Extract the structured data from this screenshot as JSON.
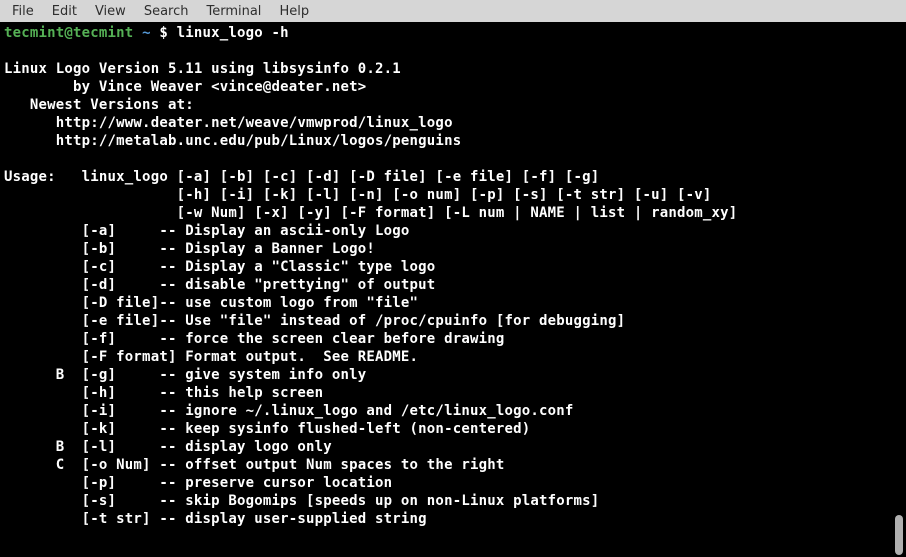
{
  "menubar": {
    "items": [
      "File",
      "Edit",
      "View",
      "Search",
      "Terminal",
      "Help"
    ]
  },
  "prompt": {
    "user": "tecmint@tecmint",
    "path": "~",
    "symbol": "$",
    "command": "linux_logo -h"
  },
  "output": {
    "lines": [
      "",
      "Linux Logo Version 5.11 using libsysinfo 0.2.1",
      "        by Vince Weaver <vince@deater.net>",
      "   Newest Versions at:",
      "      http://www.deater.net/weave/vmwprod/linux_logo",
      "      http://metalab.unc.edu/pub/Linux/logos/penguins",
      "",
      "Usage:   linux_logo [-a] [-b] [-c] [-d] [-D file] [-e file] [-f] [-g]",
      "                    [-h] [-i] [-k] [-l] [-n] [-o num] [-p] [-s] [-t str] [-u] [-v]",
      "                    [-w Num] [-x] [-y] [-F format] [-L num | NAME | list | random_xy]",
      "         [-a]     -- Display an ascii-only Logo",
      "         [-b]     -- Display a Banner Logo!",
      "         [-c]     -- Display a \"Classic\" type logo",
      "         [-d]     -- disable \"prettying\" of output",
      "         [-D file]-- use custom logo from \"file\"",
      "         [-e file]-- Use \"file\" instead of /proc/cpuinfo [for debugging]",
      "         [-f]     -- force the screen clear before drawing",
      "         [-F format] Format output.  See README.",
      "      B  [-g]     -- give system info only",
      "         [-h]     -- this help screen",
      "         [-i]     -- ignore ~/.linux_logo and /etc/linux_logo.conf",
      "         [-k]     -- keep sysinfo flushed-left (non-centered)",
      "      B  [-l]     -- display logo only",
      "      C  [-o Num] -- offset output Num spaces to the right",
      "         [-p]     -- preserve cursor location",
      "         [-s]     -- skip Bogomips [speeds up on non-Linux platforms]",
      "         [-t str] -- display user-supplied string"
    ]
  }
}
